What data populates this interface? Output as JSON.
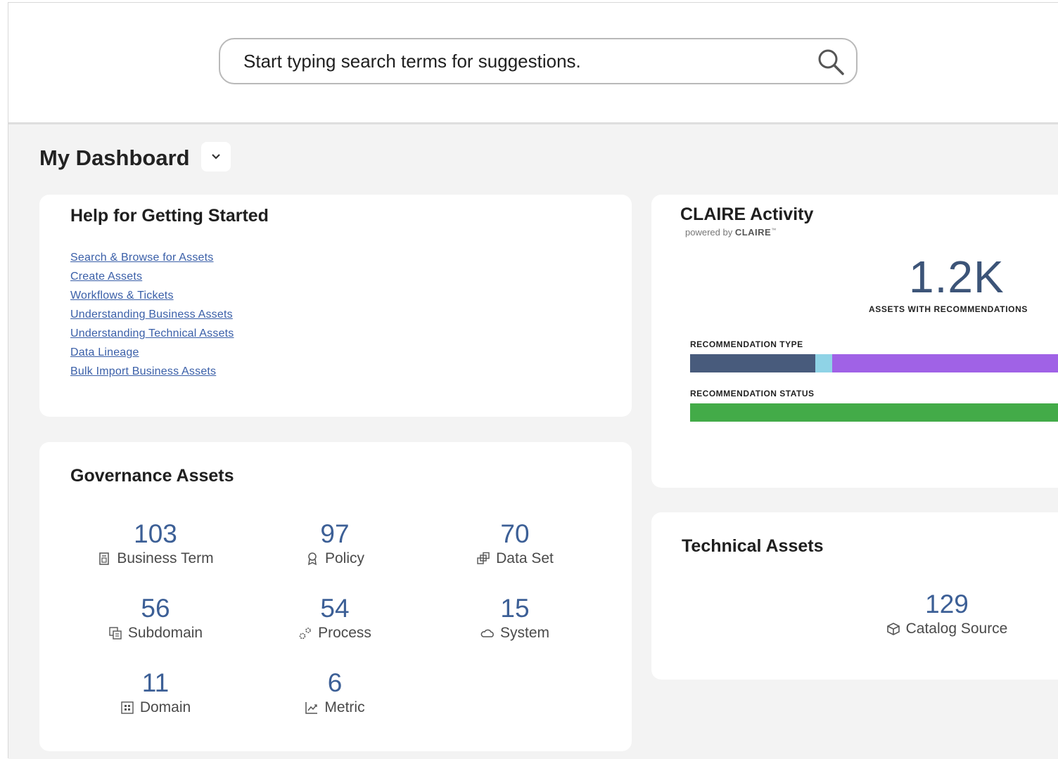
{
  "search": {
    "placeholder": "Start typing search terms for suggestions."
  },
  "dashboard": {
    "title": "My Dashboard"
  },
  "help": {
    "title": "Help for Getting Started",
    "links": [
      "Search & Browse for Assets",
      "Create Assets",
      "Workflows & Tickets",
      "Understanding Business Assets",
      "Understanding Technical Assets",
      "Data Lineage",
      "Bulk Import Business Assets"
    ]
  },
  "governance": {
    "title": "Governance Assets",
    "items": [
      {
        "count": "103",
        "label": "Business Term",
        "icon": "business-term-icon"
      },
      {
        "count": "97",
        "label": "Policy",
        "icon": "policy-icon"
      },
      {
        "count": "70",
        "label": "Data Set",
        "icon": "data-set-icon"
      },
      {
        "count": "56",
        "label": "Subdomain",
        "icon": "subdomain-icon"
      },
      {
        "count": "54",
        "label": "Process",
        "icon": "process-icon"
      },
      {
        "count": "15",
        "label": "System",
        "icon": "system-icon"
      },
      {
        "count": "11",
        "label": "Domain",
        "icon": "domain-icon"
      },
      {
        "count": "6",
        "label": "Metric",
        "icon": "metric-icon"
      }
    ]
  },
  "claire": {
    "title": "CLAIRE Activity",
    "powered_prefix": "powered by",
    "powered_brand": "CLAIRE",
    "total": "1.2K",
    "total_label": "ASSETS WITH RECOMMENDATIONS",
    "type_label": "RECOMMENDATION TYPE",
    "status_label": "RECOMMENDATION STATUS",
    "type_segments": [
      {
        "fraction": 0.327,
        "color": "#485b7c"
      },
      {
        "fraction": 0.044,
        "color": "#8fd3e6"
      },
      {
        "fraction": 0.629,
        "color": "#a062e6"
      }
    ],
    "status_segments": [
      {
        "fraction": 1.0,
        "color": "#43ab48"
      }
    ]
  },
  "technical": {
    "title": "Technical Assets",
    "items": [
      {
        "count": "129",
        "label": "Catalog Source",
        "icon": "catalog-source-icon"
      }
    ]
  }
}
